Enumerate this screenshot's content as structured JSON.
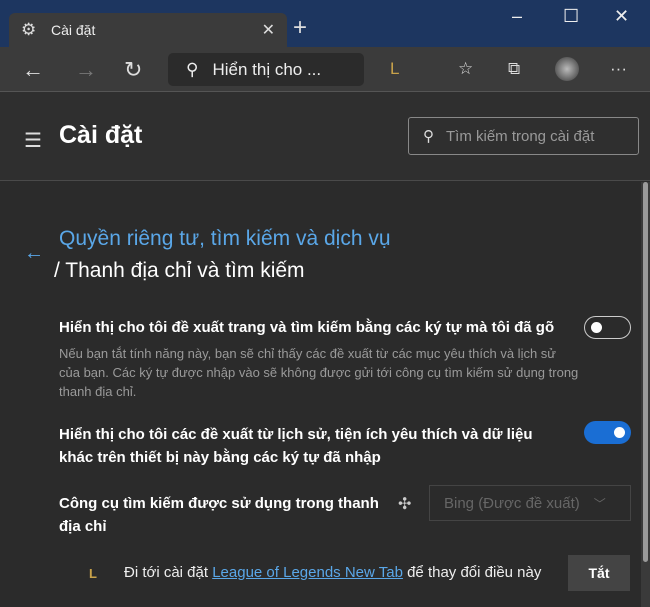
{
  "window": {
    "tab_title": "Cài đặt",
    "minimize": "–",
    "maximize": "☐",
    "close": "✕",
    "new_tab": "+",
    "tab_close": "✕"
  },
  "toolbar": {
    "address_text": "Hiển thị cho ...",
    "more": "···"
  },
  "header": {
    "title": "Cài đặt",
    "search_placeholder": "Tìm kiếm trong cài đặt"
  },
  "page": {
    "breadcrumb_parent": "Quyền riêng tư, tìm kiếm và dịch vụ",
    "subtitle": "/ Thanh địa chỉ và tìm kiếm",
    "settings": [
      {
        "label": "Hiển thị cho tôi đề xuất trang và tìm kiếm bằng các ký tự mà tôi đã gõ",
        "description": "Nếu bạn tắt tính năng này, bạn sẽ chỉ thấy các đề xuất từ các mục yêu thích và lịch sử của bạn. Các ký tự được nhập vào sẽ không được gửi tới công cụ tìm kiếm sử dụng trong thanh địa chỉ.",
        "enabled": false
      },
      {
        "label": "Hiển thị cho tôi các đề xuất từ lịch sử, tiện ích yêu thích và dữ liệu khác trên thiết bị này bằng các ký tự đã nhập",
        "enabled": true
      }
    ],
    "search_engine": {
      "label": "Công cụ tìm kiếm được sử dụng trong thanh địa chỉ",
      "value": "Bing (Được đề xuất)"
    },
    "extension_notice": {
      "prefix": "Đi tới cài đặt ",
      "link": "League of Legends New Tab",
      "suffix": " để thay đổi điều này",
      "button": "Tắt"
    }
  }
}
